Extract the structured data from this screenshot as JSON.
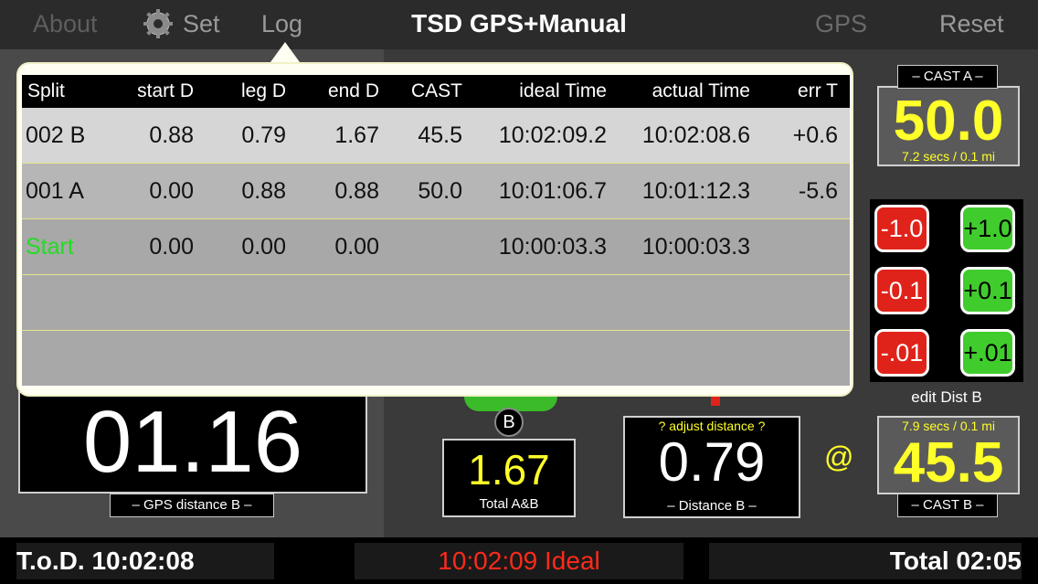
{
  "nav": {
    "about": "About",
    "set": "Set",
    "log": "Log",
    "title": "TSD GPS+Manual",
    "gps": "GPS",
    "reset": "Reset"
  },
  "log": {
    "headers": [
      "Split",
      "start D",
      "leg D",
      "end D",
      "CAST",
      "ideal Time",
      "actual Time",
      "err T"
    ],
    "rows": [
      [
        "002 B",
        "0.88",
        "0.79",
        "1.67",
        "45.5",
        "10:02:09.2",
        "10:02:08.6",
        "+0.6"
      ],
      [
        "001 A",
        "0.00",
        "0.88",
        "0.88",
        "50.0",
        "10:01:06.7",
        "10:01:12.3",
        "-5.6"
      ],
      [
        "Start",
        "0.00",
        "0.00",
        "0.00",
        "",
        "10:00:03.3",
        "10:00:03.3",
        ""
      ]
    ]
  },
  "castA": {
    "label": "– CAST A –",
    "value": "50.0",
    "rate": "7.2 secs / 0.1 mi"
  },
  "castB": {
    "label": "– CAST B –",
    "value": "45.5",
    "rate": "7.9 secs / 0.1 mi"
  },
  "adjust": {
    "m1": "-1.0",
    "p1": "+1.0",
    "m01": "-0.1",
    "p01": "+0.1",
    "m001": "-.01",
    "p001": "+.01",
    "edit_label": "edit Dist B"
  },
  "gps": {
    "value": "01.16",
    "label": "– GPS distance B –"
  },
  "marker": "B",
  "totalAB": {
    "value": "1.67",
    "label": "Total A&B"
  },
  "distB": {
    "hint": "? adjust distance ?",
    "value": "0.79",
    "label": "– Distance B –"
  },
  "at": "@",
  "bottom": {
    "tod": "T.o.D. 10:02:08",
    "ideal": "10:02:09 Ideal",
    "total": "Total 02:05"
  },
  "colors": {
    "accent_yellow": "#ffff2a",
    "ideal_red": "#ff2a1a",
    "plus_green": "#41cc2e",
    "minus_red": "#e0231a",
    "start_green": "#22dd22"
  }
}
